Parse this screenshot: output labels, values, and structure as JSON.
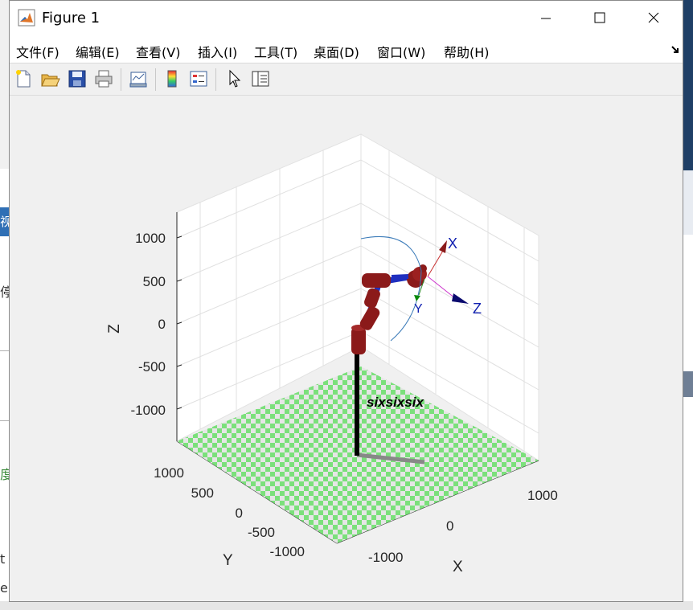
{
  "window": {
    "title": "Figure 1"
  },
  "menu": [
    {
      "label": "文件(F)"
    },
    {
      "label": "编辑(E)"
    },
    {
      "label": "查看(V)"
    },
    {
      "label": "插入(I)"
    },
    {
      "label": "工具(T)"
    },
    {
      "label": "桌面(D)"
    },
    {
      "label": "窗口(W)"
    },
    {
      "label": "帮助(H)"
    }
  ],
  "toolbar": [
    {
      "icon": "new-figure-icon"
    },
    {
      "icon": "open-file-icon"
    },
    {
      "icon": "save-icon"
    },
    {
      "icon": "print-icon"
    },
    {
      "icon": "link-plot-icon"
    },
    {
      "icon": "insert-colorbar-icon"
    },
    {
      "icon": "insert-legend-icon"
    },
    {
      "icon": "edit-plot-icon"
    },
    {
      "icon": "property-inspector-icon"
    }
  ],
  "axes": {
    "xlabel": "X",
    "ylabel": "Y",
    "zlabel": "Z",
    "x_ticks": [
      "1000",
      "0",
      "-1000"
    ],
    "y_ticks": [
      "1000",
      "500",
      "0",
      "-500",
      "-1000"
    ],
    "z_ticks": [
      "1000",
      "500",
      "0",
      "-500",
      "-1000"
    ]
  },
  "robot": {
    "name": "sixsixsix",
    "frame_labels": {
      "x": "X",
      "y": "Y",
      "z": "Z"
    },
    "link_color": "#8b1a1a",
    "joint_color": "#1f2fbf",
    "floor_colors": [
      "#7be07b",
      "#e6e6e6"
    ]
  },
  "background": {
    "left_fragments": [
      "视",
      "停",
      "度",
      "t",
      "e"
    ]
  }
}
